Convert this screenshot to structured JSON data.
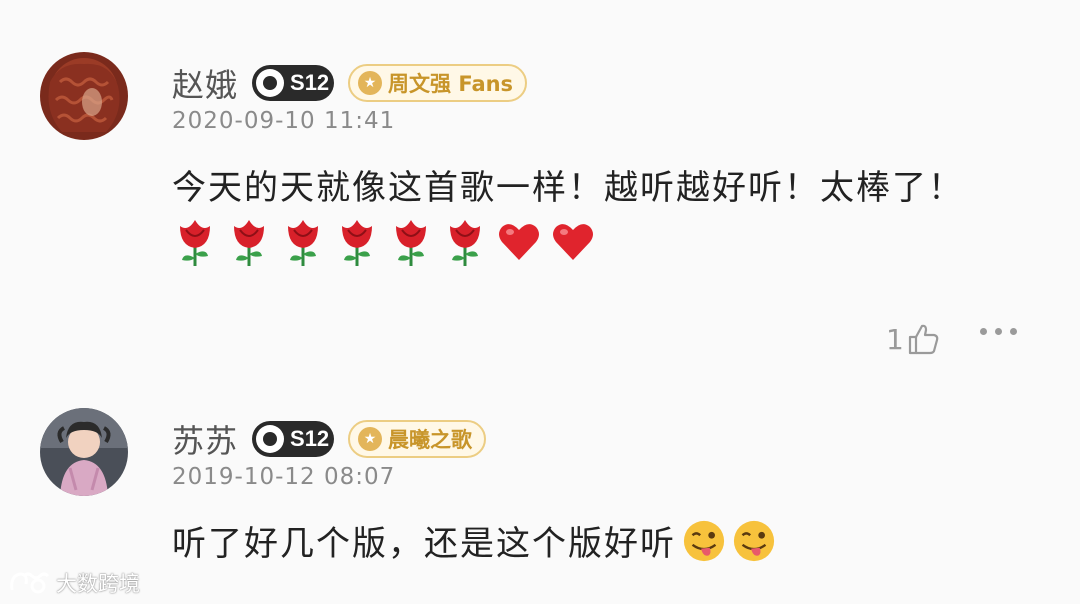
{
  "comments": [
    {
      "username": "赵娥",
      "level": "S12",
      "fan_badge": "周文强 Fans",
      "timestamp": "2020-09-10 11:41",
      "text": "今天的天就像这首歌一样！越听越好听！太棒了！",
      "emojis": [
        "rose-emoji",
        "rose-emoji",
        "rose-emoji",
        "rose-emoji",
        "rose-emoji",
        "rose-emoji",
        "heart-emoji",
        "heart-emoji"
      ],
      "like_count": "1"
    },
    {
      "username": "苏苏",
      "level": "S12",
      "fan_badge": "晨曦之歌",
      "timestamp": "2019-10-12 08:07",
      "text": "听了好几个版，还是这个版好听",
      "emojis": [
        "winking-tongue-emoji",
        "winking-tongue-emoji"
      ]
    }
  ],
  "watermark": "大数跨境",
  "colors": {
    "background": "#fafafa",
    "badge_gold": "#c8952a",
    "badge_bg": "#fff8e7",
    "level_badge": "#2a2a2a"
  }
}
